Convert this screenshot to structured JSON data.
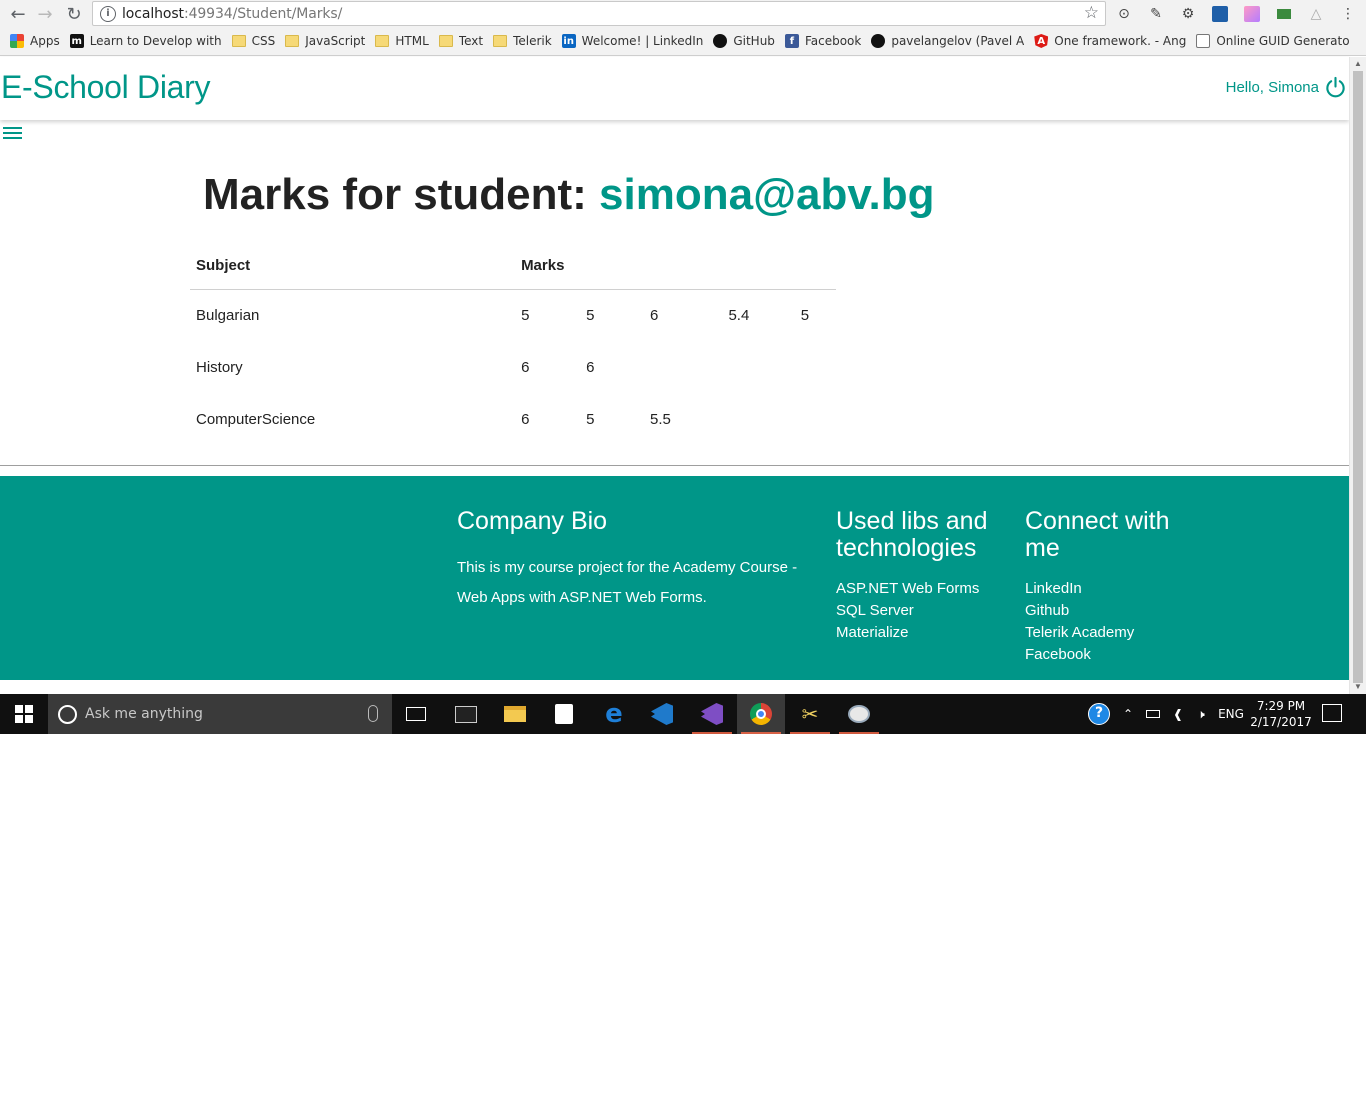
{
  "browser": {
    "url_host": "localhost",
    "url_path": ":49934/Student/Marks/",
    "bookmarks": [
      {
        "label": "Apps",
        "icon": "apps-grid-icon"
      },
      {
        "label": "Learn to Develop with",
        "icon": "m-icon"
      },
      {
        "label": "CSS",
        "icon": "folder-icon"
      },
      {
        "label": "JavaScript",
        "icon": "folder-icon"
      },
      {
        "label": "HTML",
        "icon": "folder-icon"
      },
      {
        "label": "Text",
        "icon": "folder-icon"
      },
      {
        "label": "Telerik",
        "icon": "folder-icon"
      },
      {
        "label": "Welcome! | LinkedIn",
        "icon": "linkedin-icon"
      },
      {
        "label": "GitHub",
        "icon": "github-icon"
      },
      {
        "label": "Facebook",
        "icon": "facebook-icon"
      },
      {
        "label": "pavelangelov (Pavel A",
        "icon": "github-icon"
      },
      {
        "label": "One framework. - Ang",
        "icon": "angular-icon"
      },
      {
        "label": "Online GUID Generato",
        "icon": "page-icon"
      }
    ]
  },
  "navbar": {
    "brand": "E-School Diary",
    "greeting": "Hello, Simona"
  },
  "main": {
    "heading_prefix": "Marks for student: ",
    "student_email": "simona@abv.bg",
    "table": {
      "headers": [
        "Subject",
        "Marks"
      ],
      "rows": [
        {
          "subject": "Bulgarian",
          "marks": [
            "5",
            "5",
            "6",
            "5.4",
            "5"
          ]
        },
        {
          "subject": "History",
          "marks": [
            "6",
            "6"
          ]
        },
        {
          "subject": "ComputerScience",
          "marks": [
            "6",
            "5",
            "5.5"
          ]
        }
      ]
    }
  },
  "footer": {
    "bio_title": "Company Bio",
    "bio_text": "This is my course project for the Academy Course - Web Apps with ASP.NET Web Forms.",
    "libs_title": "Used libs and technologies",
    "libs": [
      "ASP.NET Web Forms",
      "SQL Server",
      "Materialize"
    ],
    "connect_title": "Connect with me",
    "connect_links": [
      "LinkedIn",
      "Github",
      "Telerik Academy",
      "Facebook"
    ]
  },
  "taskbar": {
    "search_placeholder": "Ask me anything",
    "language": "ENG",
    "time": "7:29 PM",
    "date": "2/17/2017"
  },
  "colors": {
    "accent": "#009688",
    "taskbar": "#101010"
  }
}
